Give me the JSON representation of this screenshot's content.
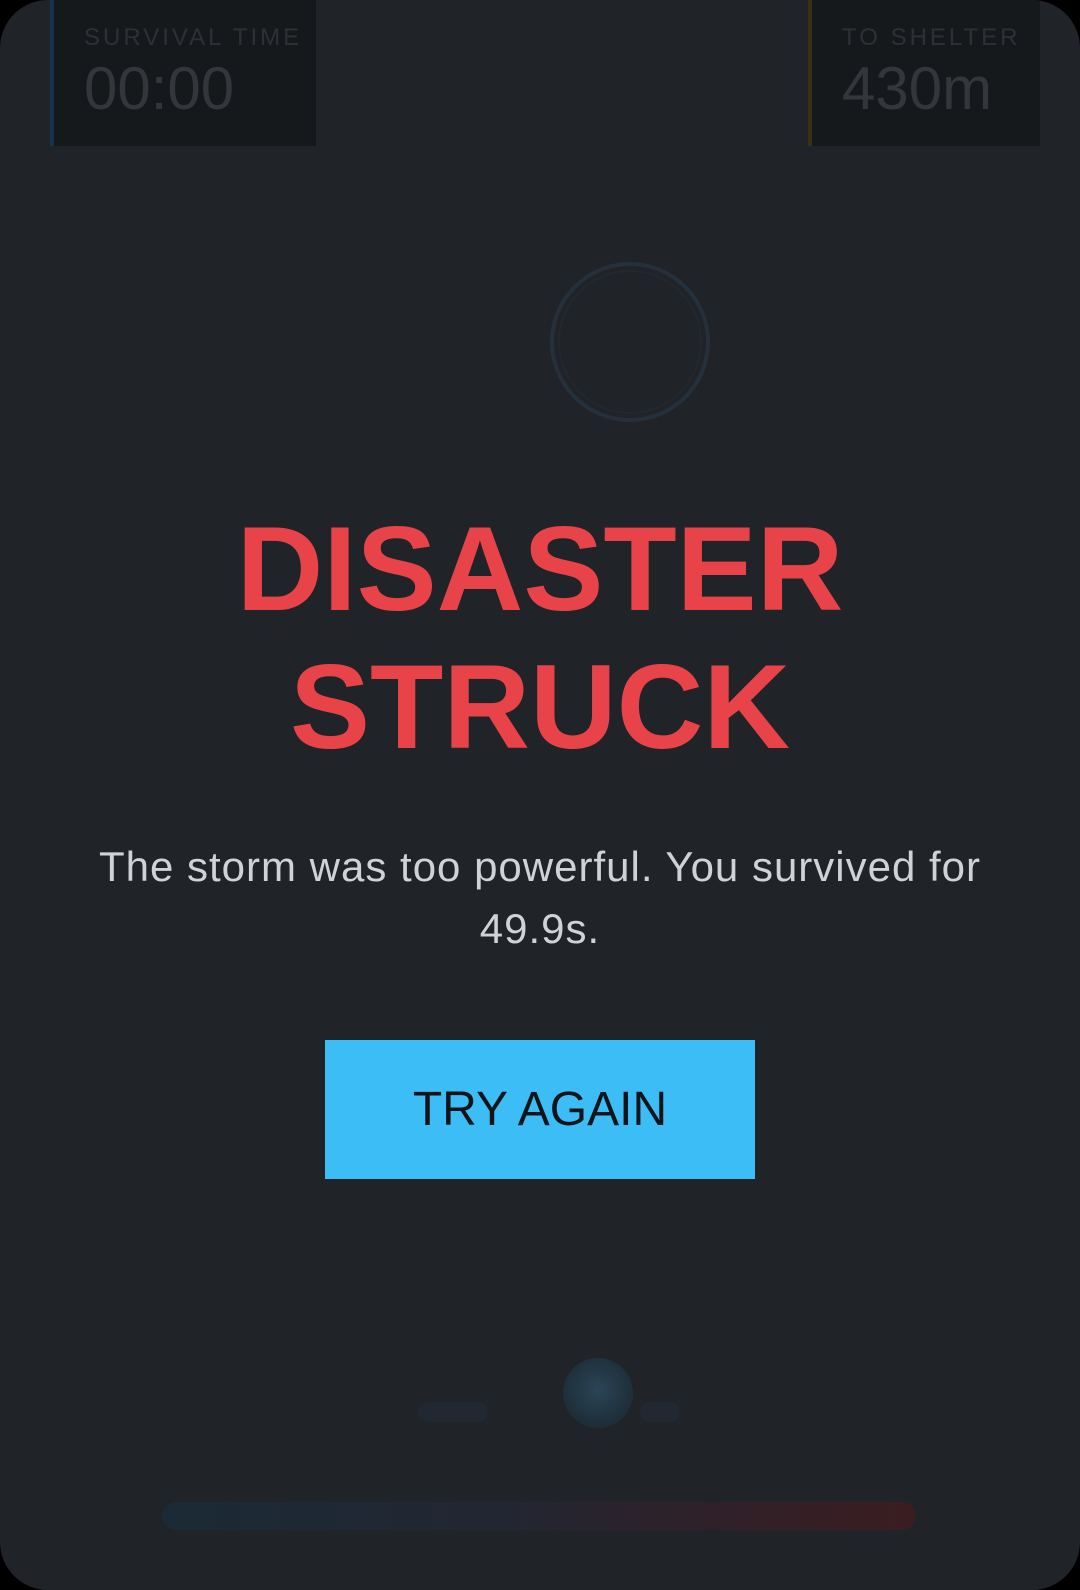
{
  "hud": {
    "survival": {
      "label": "SURVIVAL TIME",
      "value": "00:00"
    },
    "shelter": {
      "label": "TO SHELTER",
      "value": "430m"
    }
  },
  "game_over": {
    "title_line1": "DISASTER",
    "title_line2": "STRUCK",
    "message_line1": "The storm was too powerful. You survived for",
    "message_line2": "49.9s.",
    "button_label": "TRY AGAIN"
  },
  "colors": {
    "background": "#202327",
    "title": "#e9434a",
    "button": "#3dbdf5",
    "message": "#cfd3d7"
  }
}
